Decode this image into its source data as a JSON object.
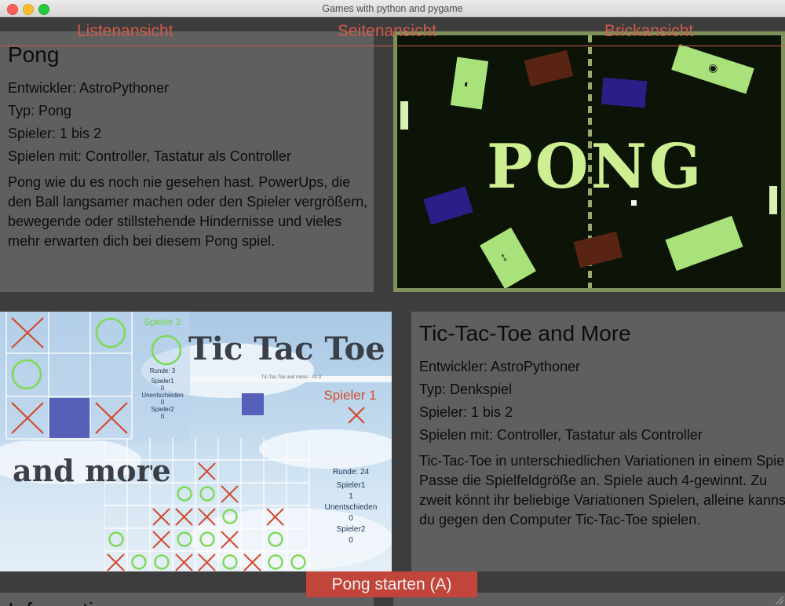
{
  "window": {
    "title": "Games with python and pygame"
  },
  "nav": {
    "tabs": [
      "Listenansicht",
      "Seitenansicht",
      "Brickansicht"
    ]
  },
  "games": [
    {
      "title": "Pong",
      "developer": "Entwickler: AstroPythoner",
      "type": "Typ: Pong",
      "players": "Spieler: 1 bis 2",
      "controls": "Spielen mit: Controller, Tastatur als Controller",
      "description": "Pong wie du es noch nie gesehen hast. PowerUps, die den Ball langsamer machen oder den Spieler vergrößern, bewegende oder stillstehende Hindernisse und vieles mehr erwarten dich bei diesem Pong spiel.",
      "image": {
        "word": "PONG"
      }
    },
    {
      "title": "Tic-Tac-Toe and More",
      "developer": "Entwickler: AstroPythoner",
      "type": "Typ: Denkspiel",
      "players": "Spieler: 1 bis 2",
      "controls": "Spielen mit: Controller, Tastatur als Controller",
      "description": "Tic-Tac-Toe in unterschiedlichen Variationen in einem Spiel. Passe die Spielfeldgröße an. Spiele auch 4-gewinnt. Zu zweit könnt ihr beliebige Variationen Spielen, alleine kannst du gegen den Computer Tic-Tac-Toe spielen.",
      "image": {
        "title_line1": "Tic Tac Toe",
        "title_line2": "and more",
        "small_board": {
          "player_label": "Spieler 2",
          "score_lines": [
            "Runde: 3",
            "Spieler1",
            "0",
            "Unentschieden",
            "0",
            "Spieler2",
            "0"
          ],
          "window_caption": "Tic-Tac-Toe and more! - v1.0"
        },
        "spieler1_label": "Spieler 1",
        "score_lines": [
          "Runde: 24",
          "Spieler1",
          "1",
          "Unentschieden",
          "0",
          "Spieler2",
          "0"
        ]
      }
    }
  ],
  "bottom": {
    "start_button": "Pong starten (A)",
    "info_heading": "Informationen"
  },
  "colors": {
    "accent": "#cf5a4a",
    "button_bg": "#c1453a",
    "panel_bg": "#5f5f5f",
    "background": "#3d3d3d",
    "x_color": "#d24b2e",
    "o_color": "#7ed957"
  }
}
